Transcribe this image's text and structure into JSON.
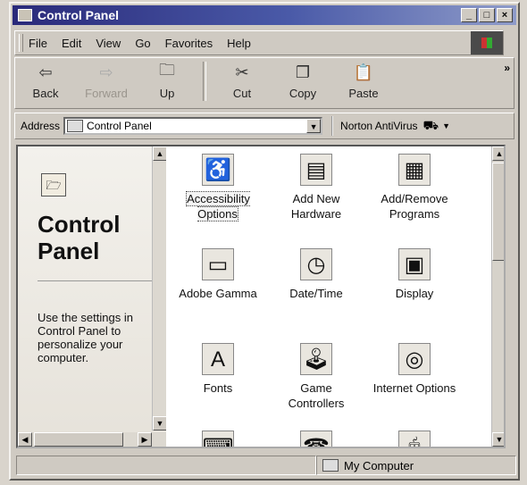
{
  "window": {
    "title": "Control Panel"
  },
  "titlebar_buttons": {
    "minimize": "_",
    "maximize": "□",
    "close": "×"
  },
  "menu": [
    {
      "label": "File"
    },
    {
      "label": "Edit"
    },
    {
      "label": "View"
    },
    {
      "label": "Go"
    },
    {
      "label": "Favorites"
    },
    {
      "label": "Help"
    }
  ],
  "toolbar": {
    "back": "Back",
    "forward": "Forward",
    "up": "Up",
    "cut": "Cut",
    "copy": "Copy",
    "paste": "Paste",
    "more": "»"
  },
  "address": {
    "label": "Address",
    "value": "Control Panel"
  },
  "norton": {
    "label": "Norton AntiVirus"
  },
  "left_pane": {
    "title": "Control Panel",
    "description": "Use the settings in Control Panel to personalize your computer."
  },
  "icons": [
    {
      "label": "Accessibility Options",
      "icon": "wheelchair-icon",
      "selected": true
    },
    {
      "label": "Add New Hardware",
      "icon": "hardware-icon"
    },
    {
      "label": "Add/Remove Programs",
      "icon": "programs-icon"
    },
    {
      "label": "Adobe Gamma",
      "icon": "monitor-icon"
    },
    {
      "label": "Date/Time",
      "icon": "calendar-clock-icon"
    },
    {
      "label": "Display",
      "icon": "display-icon"
    },
    {
      "label": "Fonts",
      "icon": "fonts-folder-icon"
    },
    {
      "label": "Game Controllers",
      "icon": "joystick-icon"
    },
    {
      "label": "Internet Options",
      "icon": "globe-icon"
    }
  ],
  "status": {
    "zone": "My Computer"
  }
}
